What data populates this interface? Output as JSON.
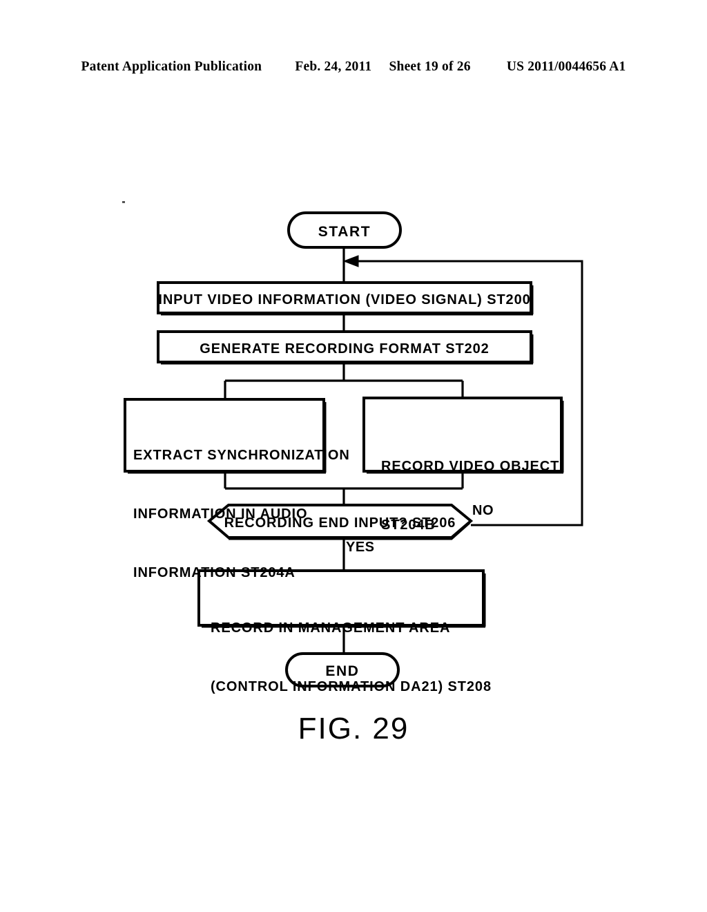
{
  "header": {
    "publication": "Patent Application Publication",
    "date": "Feb. 24, 2011",
    "sheet": "Sheet 19 of 26",
    "number": "US 2011/0044656 A1"
  },
  "figure": {
    "caption": "FIG. 29",
    "nodes": {
      "start": {
        "label": "START",
        "shape": "terminal"
      },
      "st200": {
        "label": "INPUT VIDEO INFORMATION (VIDEO SIGNAL) ST200",
        "shape": "process"
      },
      "st202": {
        "label": "GENERATE RECORDING FORMAT ST202",
        "shape": "process"
      },
      "st204a": {
        "line1": "EXTRACT SYNCHRONIZATION",
        "line2": "INFORMATION IN AUDIO",
        "line3": "INFORMATION ST204A",
        "shape": "process"
      },
      "st204b": {
        "line1": "RECORD VIDEO OBJECT",
        "line2": "ST204B",
        "shape": "process"
      },
      "st206": {
        "label": "RECORDING END INPUT? ST206",
        "shape": "decision"
      },
      "st208": {
        "line1": "RECORD IN MANAGEMENT AREA",
        "line2": "(CONTROL INFORMATION DA21) ST208",
        "shape": "process"
      },
      "end": {
        "label": "END",
        "shape": "terminal"
      }
    },
    "branches": {
      "no": "NO",
      "yes": "YES"
    },
    "colors": {
      "stroke": "#000000",
      "fill": "#ffffff",
      "background": "#ffffff"
    }
  }
}
